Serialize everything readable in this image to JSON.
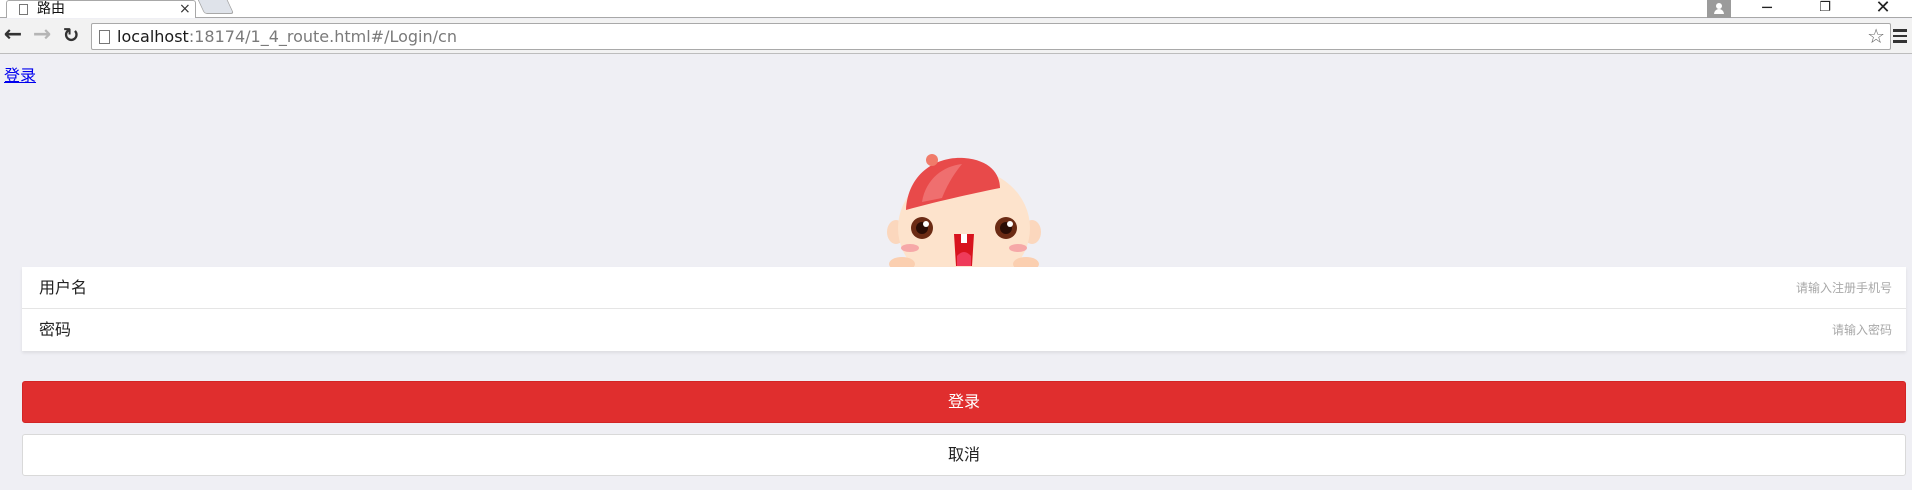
{
  "browser": {
    "tab_title": "路由",
    "tab_close": "×",
    "url_host": "localhost",
    "url_rest": ":18174/1_4_route.html#/Login/cn",
    "window_controls": {
      "minimize": "─",
      "restore": "❐",
      "close": "✕"
    },
    "icons": [
      "page-icon",
      "back-arrow-icon",
      "forward-arrow-icon",
      "reload-icon",
      "bookmark-star-icon",
      "menu-icon",
      "user-icon"
    ]
  },
  "page": {
    "top_link": "登录",
    "form": {
      "username_label": "用户名",
      "username_placeholder": "请输入注册手机号",
      "password_label": "密码",
      "password_placeholder": "请输入密码"
    },
    "login_button": "登录",
    "cancel_button": "取消"
  },
  "colors": {
    "background": "#efeff4",
    "primary": "#e02e2e",
    "link": "#0000ee",
    "mascot_hat": "#e84a4a",
    "mascot_skin": "#fde3cc"
  }
}
